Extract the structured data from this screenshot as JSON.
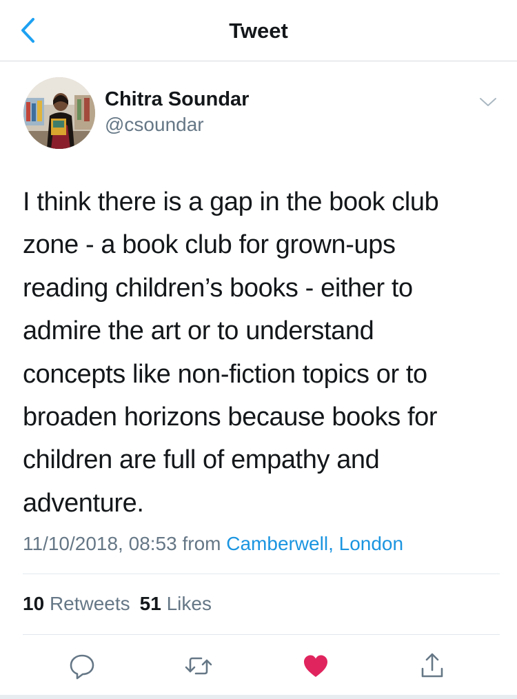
{
  "nav": {
    "title": "Tweet",
    "back_icon": "chevron-left-icon"
  },
  "tweet": {
    "author": {
      "display_name": "Chitra Soundar",
      "handle": "@csoundar"
    },
    "text_lines": [
      "I think there is a gap in the book club",
      "zone - a book club for grown-ups",
      "reading children’s books - either to",
      "admire the art or to understand",
      "concepts like non-fiction topics or to",
      "broaden horizons because books for",
      "children are full of empathy and",
      "adventure."
    ],
    "timestamp": "11/10/2018, 08:53",
    "from_label": "from",
    "location": "Camberwell, London",
    "retweets_count": "10",
    "retweets_label": "Retweets",
    "likes_count": "51",
    "likes_label": "Likes",
    "liked": true
  },
  "actions": [
    "reply-icon",
    "retweet-icon",
    "like-icon",
    "share-icon"
  ],
  "colors": {
    "accent": "#1da1f2",
    "link": "#1b95e0",
    "like": "#e0245e",
    "secondary_text": "#657786",
    "primary_text": "#14171a"
  }
}
